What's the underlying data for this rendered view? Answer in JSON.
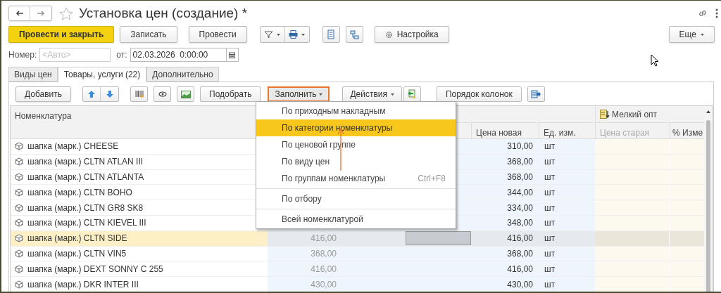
{
  "window": {
    "title": "Установка цен (создание) *"
  },
  "command_bar": {
    "buttons": [
      {
        "kind": "primary",
        "label": "Провести и закрыть"
      },
      {
        "kind": "plain",
        "label": "Записать"
      },
      {
        "kind": "plain",
        "label": "Провести"
      },
      {
        "kind": "icons"
      },
      {
        "kind": "settings",
        "label": "Настройка"
      }
    ],
    "more": "Еще"
  },
  "header_fields": {
    "number_label": "Номер:",
    "number_placeholder": "<Авто>",
    "date_label": "от:",
    "date_value": "02.03.2026  0:00:00"
  },
  "tabs": [
    {
      "label": "Виды цен",
      "selected": false
    },
    {
      "label": "Товары, услуги (22)",
      "selected": true
    },
    {
      "label": "Дополнительно",
      "selected": false
    }
  ],
  "table_toolbar": {
    "add": "Добавить",
    "pick": "Подобрать",
    "fill": "Заполнить",
    "actions": "Действия",
    "column_order": "Порядок колонок"
  },
  "fill_menu": {
    "items": [
      {
        "kind": "item",
        "label": "По приходным накладным",
        "selected": false
      },
      {
        "kind": "item",
        "label": "По категории номенклатуры",
        "selected": true
      },
      {
        "kind": "item",
        "label": "По ценовой группе",
        "selected": false
      },
      {
        "kind": "item",
        "label": "По виду цен",
        "selected": false
      },
      {
        "kind": "item",
        "label": "По группам номенклатуры",
        "shortcut": "Ctrl+F8",
        "selected": false
      },
      {
        "kind": "separator"
      },
      {
        "kind": "item",
        "label": "По отбору",
        "selected": false
      },
      {
        "kind": "separator"
      },
      {
        "kind": "item",
        "label": "Всей номенклатурой",
        "selected": false
      }
    ]
  },
  "table": {
    "columns": [
      "Номенклатура",
      "Цена новая",
      "Ед. изм."
    ],
    "group": {
      "label": "Мелкий опт",
      "columns": [
        "Цена старая",
        "% Изме"
      ]
    },
    "rows": [
      {
        "name": "шапка (марк.) CHEESE",
        "new_price": "310,00",
        "unit": "шт",
        "selected": false
      },
      {
        "name": "шапка (марк.) CLTN ATLAN III",
        "new_price": "368,00",
        "unit": "шт",
        "selected": false
      },
      {
        "name": "шапка (марк.) CLTN ATLANTA",
        "new_price": "368,00",
        "unit": "шт",
        "selected": false
      },
      {
        "name": "шапка (марк.) CLTN BOHO",
        "new_price": "344,00",
        "unit": "шт",
        "selected": false
      },
      {
        "name": "шапка (марк.) CLTN GR8 SK8",
        "new_price": "334,00",
        "unit": "шт",
        "selected": false
      },
      {
        "name": "шапка (марк.) CLTN KIEVEL III",
        "new_price": "348,00",
        "unit": "шт",
        "selected": false
      },
      {
        "name": "шапка (марк.) CLTN SIDE",
        "old_price": "416,00",
        "new_price": "416,00",
        "unit": "шт",
        "selected": true
      },
      {
        "name": "шапка (марк.) CLTN VIN5",
        "old_price": "368,00",
        "new_price": "368,00",
        "unit": "шт",
        "selected": false
      },
      {
        "name": "шапка (марк.) DEXT SONNY C 255",
        "old_price": "416,00",
        "new_price": "416,00",
        "unit": "шт",
        "selected": false
      },
      {
        "name": "шапка (марк.) DKR INTER III",
        "old_price": "430,00",
        "new_price": "430,00",
        "unit": "шт",
        "selected": false
      }
    ]
  }
}
